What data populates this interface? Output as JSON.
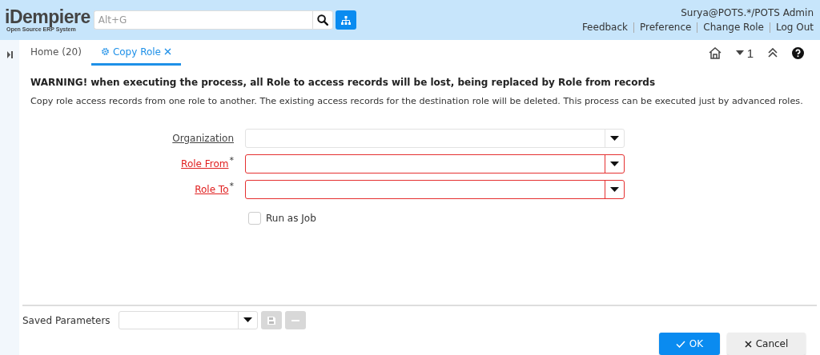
{
  "header": {
    "logo": "iDempiere",
    "logo_tagline": "Open Source ERP System",
    "search": {
      "placeholder": "Alt+G"
    },
    "user": "Surya@POTS.*/POTS Admin",
    "links": [
      "Feedback",
      "Preference",
      "Change Role",
      "Log Out"
    ]
  },
  "tabs": [
    {
      "label": "Home (20)",
      "selected": false,
      "closable": false
    },
    {
      "label": "Copy Role",
      "selected": true,
      "closable": true
    }
  ],
  "toolbar": {
    "window_count": "1"
  },
  "process": {
    "warning": "WARNING! when executing the process, all Role to access records will be lost, being replaced by Role from records",
    "description": "Copy role access records from one role to another. The existing access records for the destination role will be deleted. This process can be executed just by advanced roles.",
    "fields": [
      {
        "label": "Organization",
        "required": false
      },
      {
        "label": "Role From",
        "required": true,
        "marker": "*"
      },
      {
        "label": "Role To",
        "required": true,
        "marker": "*"
      }
    ],
    "run_as_job": {
      "label": "Run as Job",
      "checked": false
    }
  },
  "footer": {
    "saved_parameters_label": "Saved Parameters",
    "save_disabled": true,
    "delete_disabled": true,
    "buttons": [
      {
        "label": "OK",
        "kind": "primary"
      },
      {
        "label": "Cancel",
        "kind": "secondary"
      }
    ]
  }
}
